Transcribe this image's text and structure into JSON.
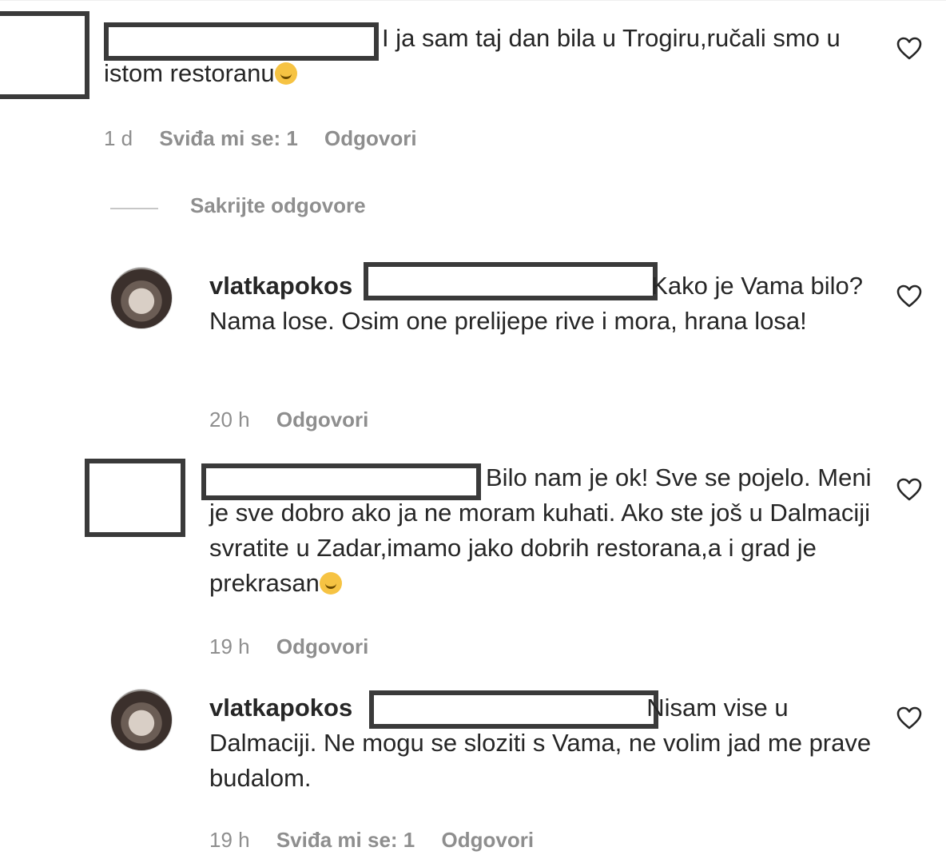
{
  "comments": [
    {
      "username": "",
      "text": "I ja sam taj dan bila u Trogiru,ručali smo u istom restoranu",
      "emoji": "smile-emoji",
      "time": "1 d",
      "likes": "Sviđa mi se: 1",
      "reply": "Odgovori"
    },
    {
      "username": "vlatkapokos",
      "text": "Kako je Vama bilo? Nama lose. Osim one prelijepe rive i mora, hrana losa!",
      "time": "20 h",
      "reply": "Odgovori"
    },
    {
      "username": "",
      "text": "Bilo nam je ok! Sve se pojelo. Meni je sve dobro ako ja ne moram kuhati. Ako ste još u Dalmaciji svratite u Zadar,imamo jako dobrih restorana,a i grad je prekrasan",
      "time": "19 h",
      "reply": "Odgovori"
    },
    {
      "username": "vlatkapokos",
      "text": "Nisam vise u Dalmaciji. Ne mogu se sloziti s Vama, ne volim jad me prave budalom.",
      "time": "19 h",
      "likes": "Sviđa mi se: 1",
      "reply": "Odgovori"
    }
  ],
  "hide_replies": "Sakrijte odgovore",
  "icons": {
    "like": "heart-icon",
    "emoji": "smile-emoji"
  }
}
